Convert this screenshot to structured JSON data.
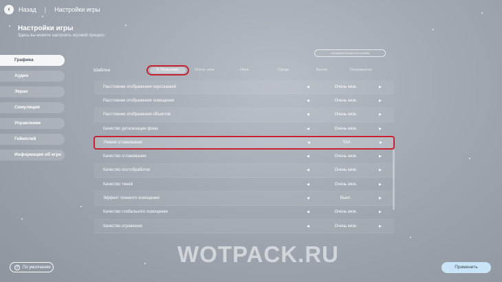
{
  "topbar": {
    "back_label": "Назад",
    "separator": "|",
    "breadcrumb": "Настройки игры",
    "back_icon": "‹"
  },
  "header": {
    "title": "Настройки игры",
    "subtitle": "Здесь вы можете настроить игровой процесс."
  },
  "sidebar": {
    "items": [
      {
        "label": "Графика",
        "active": true
      },
      {
        "label": "Аудио"
      },
      {
        "label": "Экран"
      },
      {
        "label": "Симуляция"
      },
      {
        "label": "Управление"
      },
      {
        "label": "Геймплей"
      },
      {
        "label": "Информация об игре"
      }
    ]
  },
  "top_pill": {
    "label": "Автоматическая настройка"
  },
  "presets": {
    "label": "Шаблон",
    "user_icon": "✎",
    "user_label": "Пользоват.",
    "options": [
      "Очень низк.",
      "Низк.",
      "Средн.",
      "Высок.",
      "Ультравысок."
    ]
  },
  "settings": [
    {
      "label": "Расстояние отображения персонажей",
      "value": "Очень низк."
    },
    {
      "label": "Расстояние отображения освещения",
      "value": "Очень низк."
    },
    {
      "label": "Расстояние отображения объектов",
      "value": "Очень низк."
    },
    {
      "label": "Качество детализации фона",
      "value": "Очень низк."
    },
    {
      "label": "Режим сглаживания",
      "value": "TAA",
      "highlight": true
    },
    {
      "label": "Качество сглаживания",
      "value": "Очень низк."
    },
    {
      "label": "Качество постобработки",
      "value": "Очень низк."
    },
    {
      "label": "Качество теней",
      "value": "Очень низк."
    },
    {
      "label": "Эффект теневого освещения",
      "value": "Выкл."
    },
    {
      "label": "Качество глобального освещения",
      "value": "Очень низк."
    },
    {
      "label": "Качество отражения",
      "value": "Очень низк."
    }
  ],
  "arrows": {
    "left": "◀",
    "right": "▶"
  },
  "watermark": "WOTPACK.RU",
  "footer": {
    "default_icon": "↺",
    "default_label": "По умолчанию",
    "apply_label": "Применить"
  },
  "colors": {
    "highlight": "#c8202f",
    "apply_bg": "#c9e4f6",
    "background": "#a2a9b2"
  }
}
